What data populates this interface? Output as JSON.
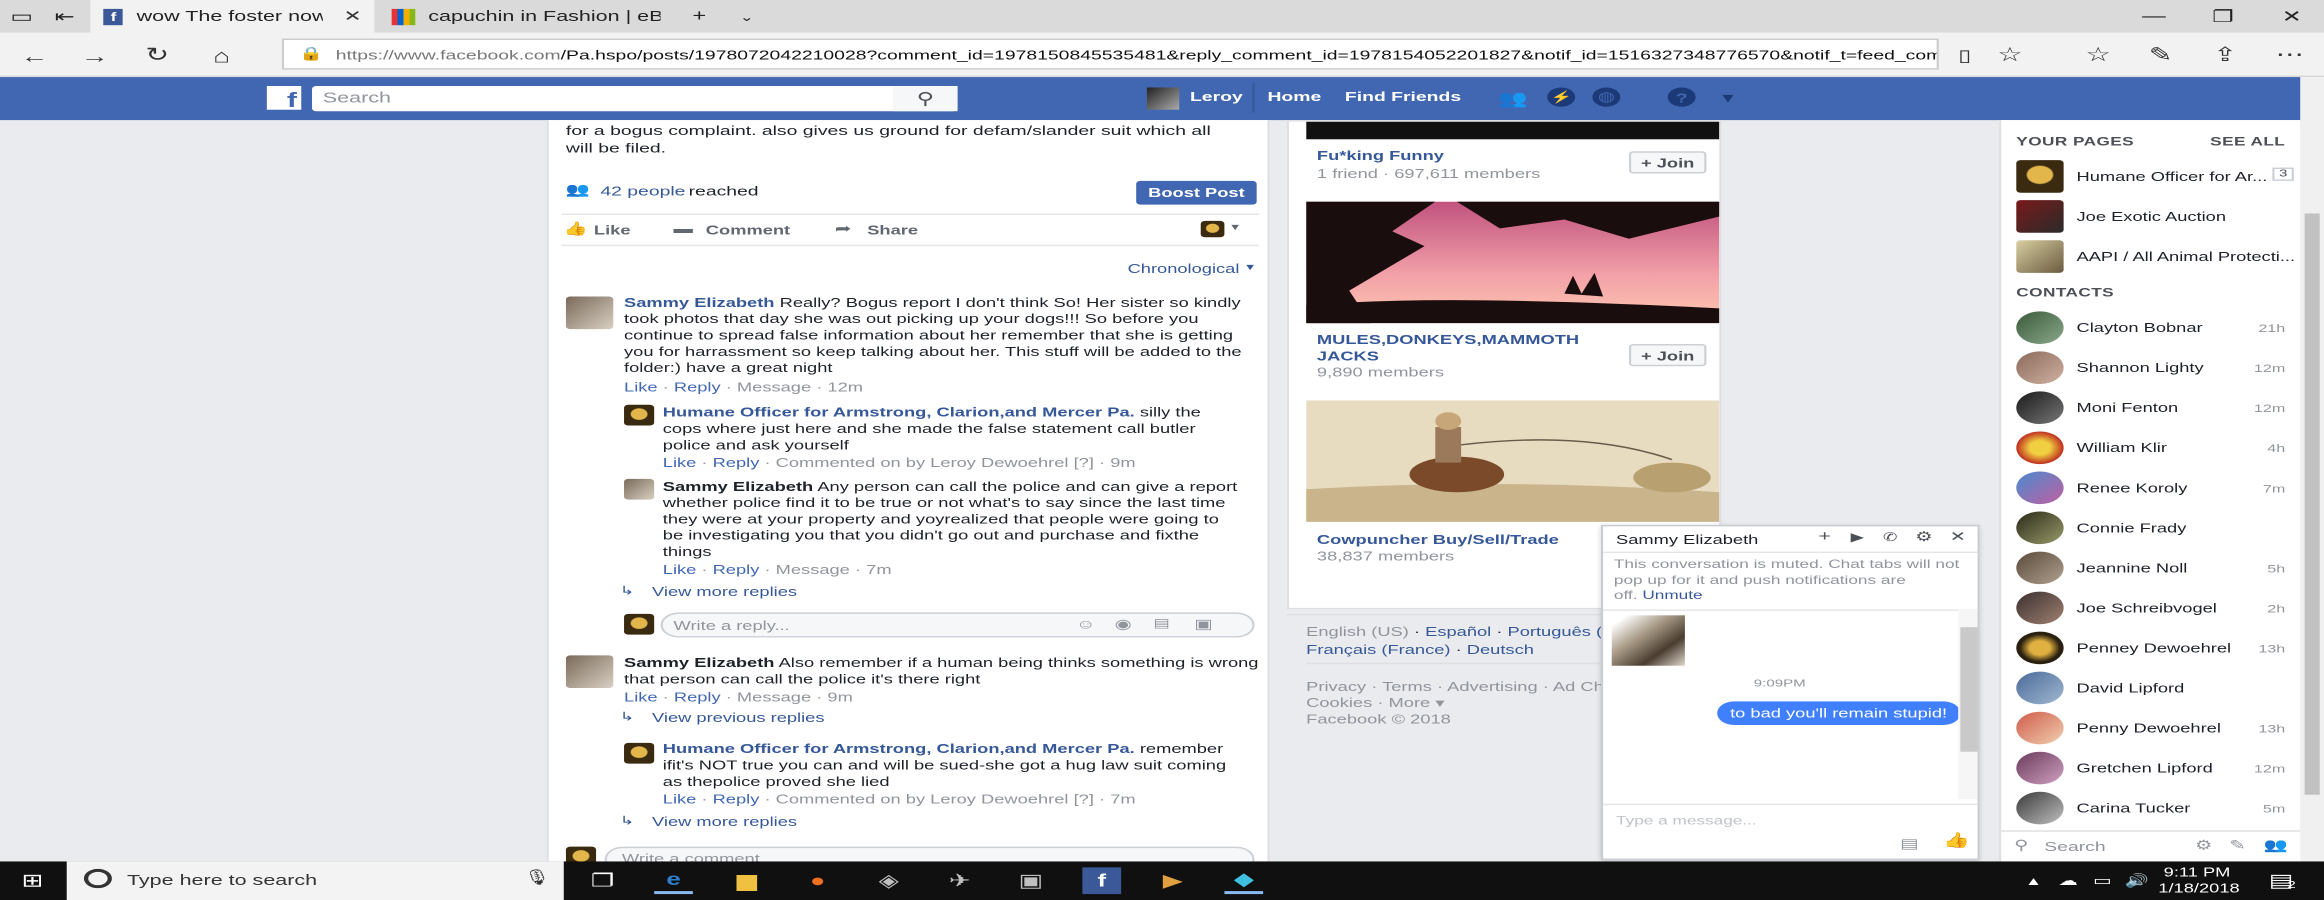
{
  "browser": {
    "tabs": [
      {
        "title": "wow The foster now cal",
        "active": true
      },
      {
        "title": "capuchin in Fashion | eBay",
        "active": false
      }
    ],
    "url_host": "https://www.facebook.com",
    "url_rest": "/Pa.hspo/posts/1978072042210028?comment_id=1978150845535481&reply_comment_id=1978154052201827&notif_id=1516327348776570&notif_t=feed_commen"
  },
  "fb_header": {
    "search_placeholder": "Search",
    "user_name": "Leroy",
    "home": "Home",
    "find_friends": "Find Friends"
  },
  "post": {
    "text_line1": "for a bogus complaint. also gives us ground for defam/slander suit which all",
    "text_line2": "will be filed.",
    "reach_count": "42 people",
    "reach_label": "reached",
    "boost_button": "Boost Post",
    "like": "Like",
    "comment": "Comment",
    "share": "Share",
    "sort": "Chronological"
  },
  "comments": {
    "c1": {
      "author": "Sammy Elizabeth",
      "line1": "Really? Bogus report I don't think So! Her sister so kindly",
      "line2": "took photos that day she was out picking up your dogs!!! So before you",
      "line3": "continue to spread false information about her remember that she is getting",
      "line4": "you for harrassment so keep talking about her. This stuff will be added to the",
      "line5": "folder:) have a great night",
      "like": "Like",
      "reply": "Reply",
      "message": "Message",
      "time": "12m"
    },
    "r1": {
      "author": "Humane Officer for Armstrong, Clarion,and Mercer Pa.",
      "line1": "silly the",
      "line2": "cops where just here and she made the false statement call butler",
      "line3": "police and ask yourself",
      "like": "Like",
      "reply": "Reply",
      "commented_on": "Commented on by Leroy Dewoehrel",
      "q": "[?]",
      "time": "9m"
    },
    "r2": {
      "author": "Sammy Elizabeth",
      "line1": "Any person can call the police and can give a report",
      "line2": "whether police find it to be true or not what's to say since the last time",
      "line3": "they were at your property and yoyrealized that people were going to",
      "line4": "be investigating you that you didn't go out and purchase and fixthe",
      "line5": "things",
      "like": "Like",
      "reply": "Reply",
      "message": "Message",
      "time": "7m"
    },
    "view_more_1": "View more replies",
    "write_reply": "Write a reply...",
    "c2": {
      "author": "Sammy Elizabeth",
      "line1": "Also remember if a human being thinks something is wrong",
      "line2": "that person can call the police it's there right",
      "like": "Like",
      "reply": "Reply",
      "message": "Message",
      "time": "9m"
    },
    "view_previous": "View previous replies",
    "r3": {
      "author": "Humane Officer for Armstrong, Clarion,and Mercer Pa.",
      "line1": "remember",
      "line2": "ifit's NOT true you can and will be sued-she got a hug law suit coming",
      "line3": "as thepolice proved she lied",
      "like": "Like",
      "reply": "Reply",
      "commented_on": "Commented on by Leroy Dewoehrel",
      "q": "[?]",
      "time": "7m"
    },
    "view_more_2": "View more replies",
    "write_comment": "Write a comment..."
  },
  "groups": [
    {
      "name": "Fu*king Funny",
      "members": "1 friend · 697,611 members",
      "join": "Join"
    },
    {
      "name": "MULES,DONKEYS,MAMMOTH JACKS",
      "members": "9,890 members",
      "join": "Join"
    },
    {
      "name": "Cowpuncher Buy/Sell/Trade",
      "members": "38,837 members"
    }
  ],
  "footer": {
    "langs1": [
      "English (US)",
      "Español",
      "Português (Br"
    ],
    "langs2": [
      "Français (France)",
      "Deutsch"
    ],
    "links1": [
      "Privacy",
      "Terms",
      "Advertising",
      "Ad Cho"
    ],
    "links2": [
      "Cookies",
      "More"
    ],
    "copyright": "Facebook © 2018"
  },
  "chat": {
    "name": "Sammy Elizabeth",
    "muted_line1": "This conversation is muted. Chat tabs will not",
    "muted_line2": "pop up for it and push notifications are",
    "muted_line3": "off.",
    "unmute": "Unmute",
    "time": "9:09PM",
    "message": "to bad you'll remain stupid!",
    "placeholder": "Type a message..."
  },
  "sidebar": {
    "your_pages": "YOUR PAGES",
    "see_all": "SEE ALL",
    "pages": [
      {
        "name": "Humane Officer for Ar...",
        "badge": "3"
      },
      {
        "name": "Joe Exotic Auction"
      },
      {
        "name": "AAPI / All Animal Protecti..."
      }
    ],
    "contacts_header": "CONTACTS",
    "contacts": [
      {
        "name": "Clayton Bobnar",
        "time": "21h"
      },
      {
        "name": "Shannon Lighty",
        "time": "12m"
      },
      {
        "name": "Moni Fenton",
        "time": "12m"
      },
      {
        "name": "William Klir",
        "time": "4h"
      },
      {
        "name": "Renee Koroly",
        "time": "7m"
      },
      {
        "name": "Connie Frady",
        "time": ""
      },
      {
        "name": "Jeannine Noll",
        "time": "5h"
      },
      {
        "name": "Joe Schreibvogel",
        "time": "2h"
      },
      {
        "name": "Penney Dewoehrel",
        "time": "13h"
      },
      {
        "name": "David Lipford",
        "time": ""
      },
      {
        "name": "Penny Dewoehrel",
        "time": "13h"
      },
      {
        "name": "Gretchen Lipford",
        "time": "12m"
      },
      {
        "name": "Carina Tucker",
        "time": "5m"
      }
    ],
    "search": "Search"
  },
  "taskbar": {
    "search": "Type here to search",
    "time": "9:11 PM",
    "date": "1/18/2018",
    "notif_count": "2"
  }
}
